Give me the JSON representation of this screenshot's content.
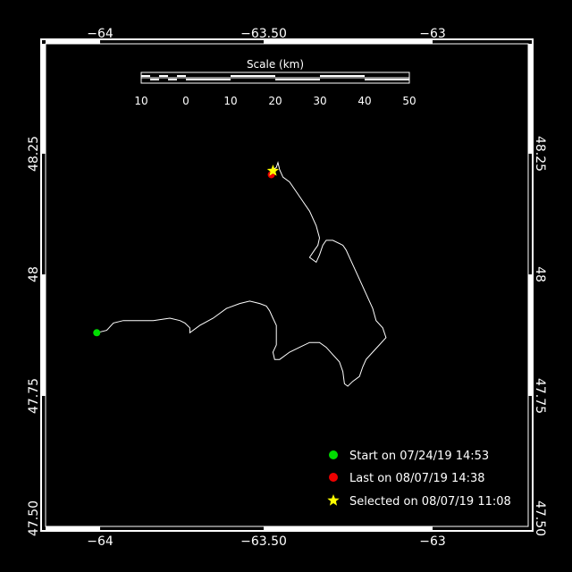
{
  "map": {
    "longitude_ticks": [
      {
        "label": "−64",
        "value": -64
      },
      {
        "label": "−63.50",
        "value": -63.5
      },
      {
        "label": "−63",
        "value": -63
      }
    ],
    "latitude_ticks": [
      {
        "label": "48.25",
        "value": 48.25
      },
      {
        "label": "48",
        "value": 48.0
      },
      {
        "label": "47.75",
        "value": 47.75
      },
      {
        "label": "47.50",
        "value": 47.5
      }
    ],
    "lon_range": [
      -64.2,
      -62.7
    ],
    "lat_range": [
      47.5,
      48.46
    ],
    "background_color": "#000000",
    "frame_color": "#ffffff",
    "track_color": "#ffffff"
  },
  "scale_bar": {
    "title": "Scale (km)",
    "labels": [
      "10",
      "0",
      "10",
      "20",
      "30",
      "40",
      "50"
    ]
  },
  "track": {
    "points": [
      [
        -64.01,
        47.88
      ],
      [
        -63.98,
        47.885
      ],
      [
        -63.96,
        47.9
      ],
      [
        -63.93,
        47.905
      ],
      [
        -63.89,
        47.905
      ],
      [
        -63.84,
        47.905
      ],
      [
        -63.79,
        47.91
      ],
      [
        -63.76,
        47.905
      ],
      [
        -63.745,
        47.9
      ],
      [
        -63.73,
        47.89
      ],
      [
        -63.73,
        47.88
      ],
      [
        -63.7,
        47.895
      ],
      [
        -63.66,
        47.91
      ],
      [
        -63.62,
        47.93
      ],
      [
        -63.58,
        47.94
      ],
      [
        -63.55,
        47.945
      ],
      [
        -63.52,
        47.94
      ],
      [
        -63.5,
        47.935
      ],
      [
        -63.49,
        47.925
      ],
      [
        -63.48,
        47.91
      ],
      [
        -63.47,
        47.895
      ],
      [
        -63.47,
        47.875
      ],
      [
        -63.47,
        47.855
      ],
      [
        -63.48,
        47.84
      ],
      [
        -63.475,
        47.825
      ],
      [
        -63.46,
        47.825
      ],
      [
        -63.43,
        47.84
      ],
      [
        -63.4,
        47.85
      ],
      [
        -63.37,
        47.86
      ],
      [
        -63.34,
        47.86
      ],
      [
        -63.32,
        47.85
      ],
      [
        -63.3,
        47.835
      ],
      [
        -63.28,
        47.82
      ],
      [
        -63.27,
        47.8
      ],
      [
        -63.265,
        47.775
      ],
      [
        -63.255,
        47.77
      ],
      [
        -63.24,
        47.78
      ],
      [
        -63.22,
        47.79
      ],
      [
        -63.21,
        47.81
      ],
      [
        -63.2,
        47.825
      ],
      [
        -63.18,
        47.84
      ],
      [
        -63.16,
        47.855
      ],
      [
        -63.14,
        47.87
      ],
      [
        -63.15,
        47.89
      ],
      [
        -63.17,
        47.905
      ],
      [
        -63.18,
        47.93
      ],
      [
        -63.2,
        47.96
      ],
      [
        -63.22,
        47.99
      ],
      [
        -63.24,
        48.02
      ],
      [
        -63.26,
        48.05
      ],
      [
        -63.27,
        48.06
      ],
      [
        -63.3,
        48.07
      ],
      [
        -63.32,
        48.07
      ],
      [
        -63.33,
        48.06
      ],
      [
        -63.34,
        48.04
      ],
      [
        -63.35,
        48.025
      ],
      [
        -63.37,
        48.035
      ],
      [
        -63.355,
        48.05
      ],
      [
        -63.345,
        48.06
      ],
      [
        -63.34,
        48.075
      ],
      [
        -63.35,
        48.1
      ],
      [
        -63.37,
        48.13
      ],
      [
        -63.39,
        48.15
      ],
      [
        -63.41,
        48.17
      ],
      [
        -63.43,
        48.19
      ],
      [
        -63.45,
        48.2
      ],
      [
        -63.46,
        48.215
      ],
      [
        -63.465,
        48.23
      ],
      [
        -63.47,
        48.22
      ],
      [
        -63.48,
        48.215
      ],
      [
        -63.485,
        48.205
      ]
    ]
  },
  "markers": {
    "start": {
      "lon": -64.01,
      "lat": 47.88,
      "color": "#00dd00"
    },
    "last": {
      "lon": -63.485,
      "lat": 48.205,
      "color": "#ee0000"
    },
    "selected": {
      "lon": -63.48,
      "lat": 48.213,
      "color": "#ffff00"
    }
  },
  "legend": {
    "start_label": "Start on 07/24/19 14:53",
    "last_label": "Last on 08/07/19 14:38",
    "selected_label": "Selected on 08/07/19 11:08",
    "start_color": "#00dd00",
    "last_color": "#ee0000",
    "selected_color": "#ffff00"
  }
}
